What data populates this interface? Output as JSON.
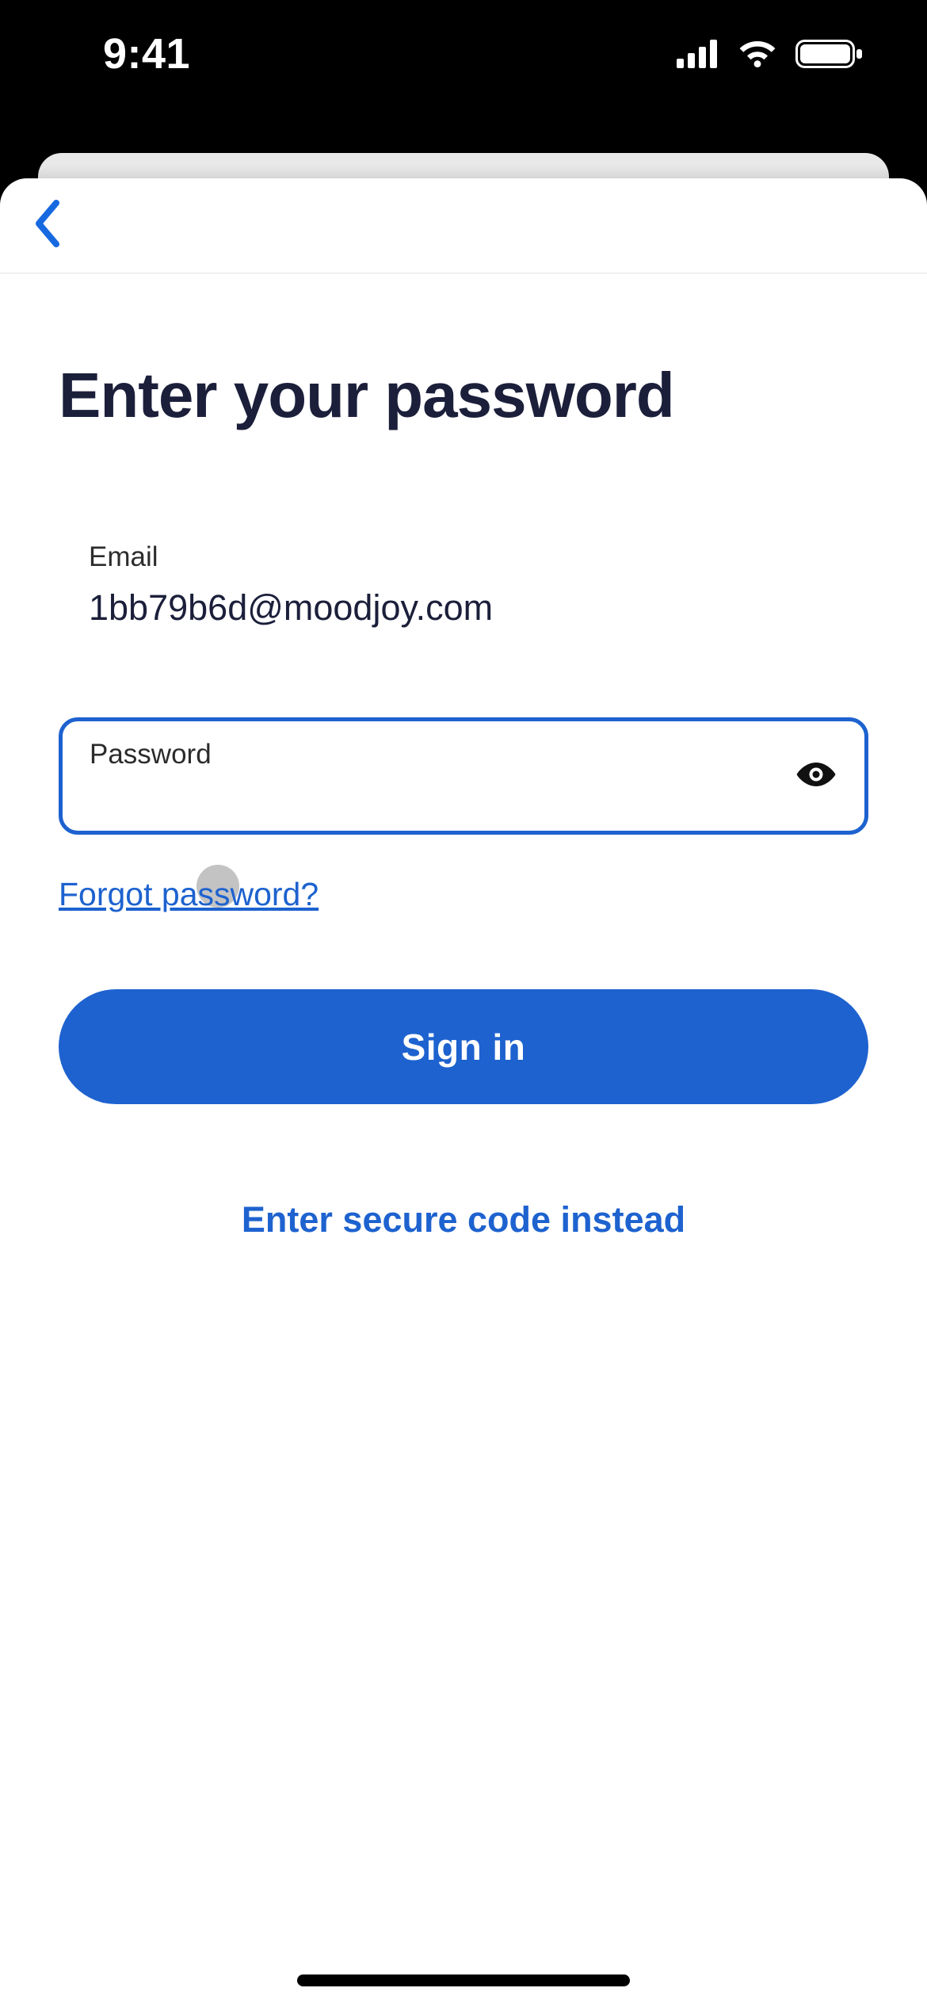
{
  "statusbar": {
    "time": "9:41"
  },
  "page": {
    "title": "Enter your password"
  },
  "email": {
    "label": "Email",
    "value": "1bb79b6d@moodjoy.com"
  },
  "password": {
    "label": "Password",
    "value": ""
  },
  "links": {
    "forgot": "Forgot password?",
    "secure_code": "Enter secure code instead"
  },
  "buttons": {
    "signin": "Sign in"
  }
}
